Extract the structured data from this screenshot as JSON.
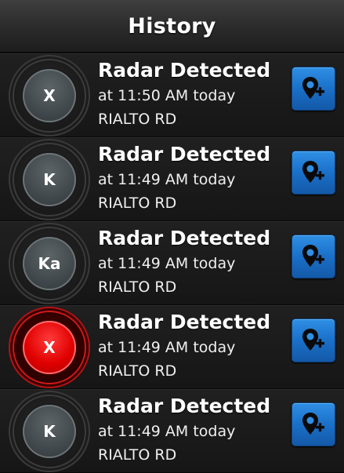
{
  "header": {
    "title": "History"
  },
  "colors": {
    "accent": "#1f78d1",
    "alert": "#e00000",
    "neutral_badge": "#4b5256"
  },
  "icons": {
    "add_location": "map-pin-plus-icon"
  },
  "history": [
    {
      "band": "X",
      "title": "Radar Detected",
      "time": "at 11:50 AM today",
      "road": "RIALTO RD",
      "alert": false
    },
    {
      "band": "K",
      "title": "Radar Detected",
      "time": "at 11:49 AM today",
      "road": "RIALTO RD",
      "alert": false
    },
    {
      "band": "Ka",
      "title": "Radar Detected",
      "time": "at 11:49 AM today",
      "road": "RIALTO RD",
      "alert": false
    },
    {
      "band": "X",
      "title": "Radar Detected",
      "time": "at 11:49 AM today",
      "road": "RIALTO RD",
      "alert": true
    },
    {
      "band": "K",
      "title": "Radar Detected",
      "time": "at 11:49 AM today",
      "road": "RIALTO RD",
      "alert": false
    }
  ]
}
